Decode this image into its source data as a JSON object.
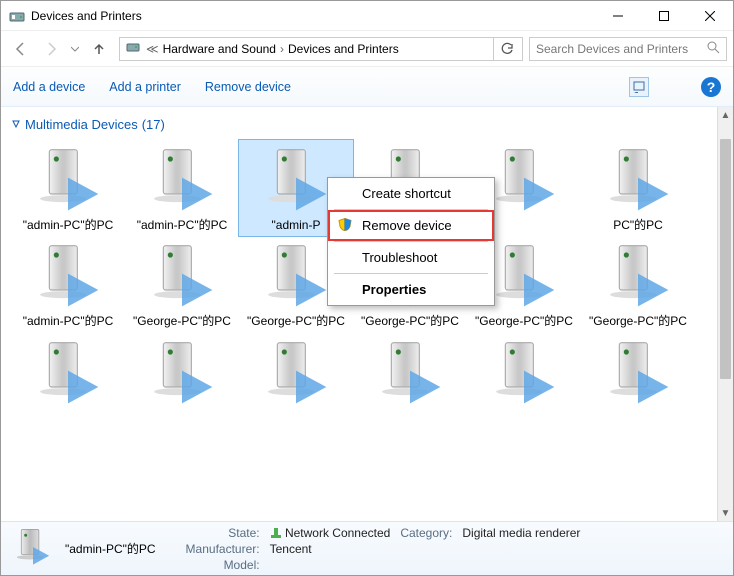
{
  "window": {
    "title": "Devices and Printers"
  },
  "nav": {
    "breadcrumb": [
      "Hardware and Sound",
      "Devices and Printers"
    ],
    "search_placeholder": "Search Devices and Printers"
  },
  "toolbar": {
    "add_device": "Add a device",
    "add_printer": "Add a printer",
    "remove_device": "Remove device"
  },
  "group": {
    "name": "Multimedia Devices",
    "count_display": "(17)"
  },
  "devices_row1": [
    {
      "label": "\"admin-PC\"的PC"
    },
    {
      "label": "\"admin-PC\"的PC"
    },
    {
      "label": "\"admin-P",
      "selected": true
    },
    {
      "label": ""
    },
    {
      "label": ""
    },
    {
      "label": "PC\"的PC"
    }
  ],
  "devices_row2": [
    {
      "label": "\"admin-PC\"的PC"
    },
    {
      "label": "\"George-PC\"的PC"
    },
    {
      "label": "\"George-PC\"的PC"
    },
    {
      "label": "\"George-PC\"的PC"
    },
    {
      "label": "\"George-PC\"的PC"
    },
    {
      "label": "\"George-PC\"的PC"
    }
  ],
  "devices_row3": [
    {
      "label": ""
    },
    {
      "label": ""
    },
    {
      "label": ""
    },
    {
      "label": ""
    },
    {
      "label": ""
    },
    {
      "label": ""
    }
  ],
  "context_menu": {
    "create_shortcut": "Create shortcut",
    "remove_device": "Remove device",
    "troubleshoot": "Troubleshoot",
    "properties": "Properties"
  },
  "status": {
    "name": "\"admin-PC\"的PC",
    "state_label": "State:",
    "state_value": "Network Connected",
    "category_label": "Category:",
    "category_value": "Digital media renderer",
    "manufacturer_label": "Manufacturer:",
    "manufacturer_value": "Tencent",
    "model_label": "Model:",
    "model_value": ""
  },
  "colors": {
    "accent": "#0a5ab4"
  }
}
